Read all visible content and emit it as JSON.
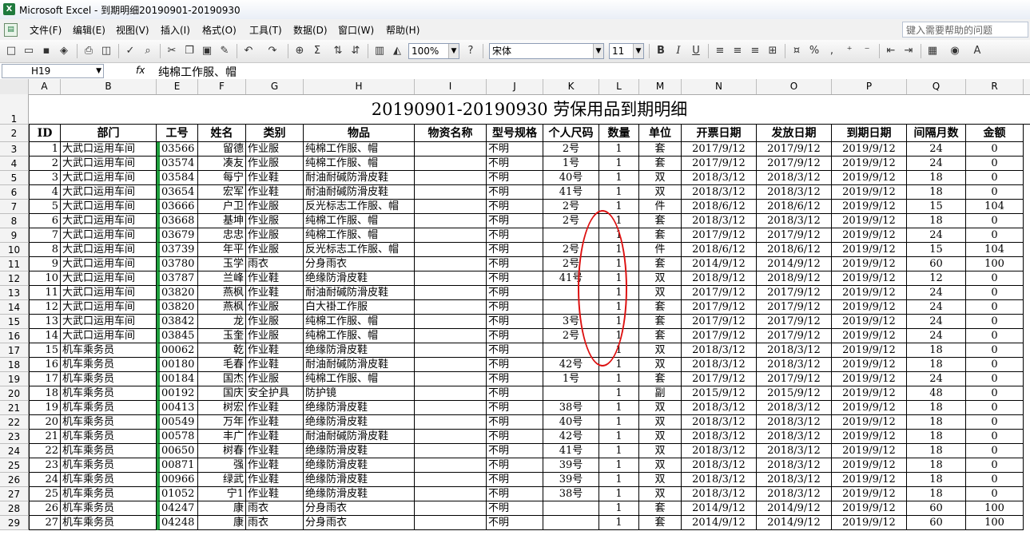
{
  "window": {
    "title": "Microsoft Excel - 到期明细20190901-20190930"
  },
  "menubar": {
    "items": [
      "文件(F)",
      "编辑(E)",
      "视图(V)",
      "插入(I)",
      "格式(O)",
      "工具(T)",
      "数据(D)",
      "窗口(W)",
      "帮助(H)"
    ],
    "help_placeholder": "键入需要帮助的问题"
  },
  "toolbar": {
    "zoom": "100%",
    "font_name": "宋体",
    "font_size": "11",
    "bold": "B",
    "italic": "I",
    "underline": "U",
    "sum": "Σ",
    "percent": "%",
    "comma": ","
  },
  "formula_bar": {
    "name_box": "H19",
    "fx": "fx",
    "content": "纯棉工作服、帽"
  },
  "columns": [
    "A",
    "B",
    "E",
    "F",
    "G",
    "H",
    "I",
    "J",
    "K",
    "L",
    "M",
    "N",
    "O",
    "P",
    "Q",
    "R"
  ],
  "row_numbers": [
    "1",
    "2",
    "3",
    "4",
    "5",
    "6",
    "7",
    "8",
    "9",
    "10",
    "11",
    "12",
    "13",
    "14",
    "15",
    "16",
    "17",
    "18",
    "19",
    "20",
    "21",
    "22",
    "23",
    "24",
    "25",
    "26",
    "27",
    "28",
    "29"
  ],
  "sheet": {
    "title": "20190901-20190930 劳保用品到期明细",
    "headers": [
      "ID",
      "部门",
      "工号",
      "姓名",
      "类别",
      "物品",
      "物资名称",
      "型号规格",
      "个人尺码",
      "数量",
      "单位",
      "开票日期",
      "发放日期",
      "到期日期",
      "间隔月数",
      "金额"
    ],
    "rows": [
      [
        "1",
        "大武口运用车间",
        "03566",
        "留德",
        "作业服",
        "纯棉工作服、帽",
        "",
        "不明",
        "2号",
        "1",
        "套",
        "2017/9/12",
        "2017/9/12",
        "2019/9/12",
        "24",
        "0"
      ],
      [
        "2",
        "大武口运用车间",
        "03574",
        "凑友",
        "作业服",
        "纯棉工作服、帽",
        "",
        "不明",
        "1号",
        "1",
        "套",
        "2017/9/12",
        "2017/9/12",
        "2019/9/12",
        "24",
        "0"
      ],
      [
        "3",
        "大武口运用车间",
        "03584",
        "每宁",
        "作业鞋",
        "耐油耐碱防滑皮鞋",
        "",
        "不明",
        "40号",
        "1",
        "双",
        "2018/3/12",
        "2018/3/12",
        "2019/9/12",
        "18",
        "0"
      ],
      [
        "4",
        "大武口运用车间",
        "03654",
        "宏军",
        "作业鞋",
        "耐油耐碱防滑皮鞋",
        "",
        "不明",
        "41号",
        "1",
        "双",
        "2018/3/12",
        "2018/3/12",
        "2019/9/12",
        "18",
        "0"
      ],
      [
        "5",
        "大武口运用车间",
        "03666",
        "户卫",
        "作业服",
        "反光标志工作服、帽",
        "",
        "不明",
        "2号",
        "1",
        "件",
        "2018/6/12",
        "2018/6/12",
        "2019/9/12",
        "15",
        "104"
      ],
      [
        "6",
        "大武口运用车间",
        "03668",
        "基坤",
        "作业服",
        "纯棉工作服、帽",
        "",
        "不明",
        "2号",
        "1",
        "套",
        "2018/3/12",
        "2018/3/12",
        "2019/9/12",
        "18",
        "0"
      ],
      [
        "7",
        "大武口运用车间",
        "03679",
        "忠忠",
        "作业服",
        "纯棉工作服、帽",
        "",
        "不明",
        "",
        "1",
        "套",
        "2017/9/12",
        "2017/9/12",
        "2019/9/12",
        "24",
        "0"
      ],
      [
        "8",
        "大武口运用车间",
        "03739",
        "年平",
        "作业服",
        "反光标志工作服、帽",
        "",
        "不明",
        "2号",
        "1",
        "件",
        "2018/6/12",
        "2018/6/12",
        "2019/9/12",
        "15",
        "104"
      ],
      [
        "9",
        "大武口运用车间",
        "03780",
        "玉学",
        "雨衣",
        "分身雨衣",
        "",
        "不明",
        "2号",
        "1",
        "套",
        "2014/9/12",
        "2014/9/12",
        "2019/9/12",
        "60",
        "100"
      ],
      [
        "10",
        "大武口运用车间",
        "03787",
        "兰峰",
        "作业鞋",
        "绝缘防滑皮鞋",
        "",
        "不明",
        "41号",
        "1",
        "双",
        "2018/9/12",
        "2018/9/12",
        "2019/9/12",
        "12",
        "0"
      ],
      [
        "11",
        "大武口运用车间",
        "03820",
        "燕枫",
        "作业鞋",
        "耐油耐碱防滑皮鞋",
        "",
        "不明",
        "",
        "1",
        "双",
        "2017/9/12",
        "2017/9/12",
        "2019/9/12",
        "24",
        "0"
      ],
      [
        "12",
        "大武口运用车间",
        "03820",
        "燕枫",
        "作业服",
        "白大褂工作服",
        "",
        "不明",
        "",
        "1",
        "套",
        "2017/9/12",
        "2017/9/12",
        "2019/9/12",
        "24",
        "0"
      ],
      [
        "13",
        "大武口运用车间",
        "03842",
        "龙",
        "作业服",
        "纯棉工作服、帽",
        "",
        "不明",
        "3号",
        "1",
        "套",
        "2017/9/12",
        "2017/9/12",
        "2019/9/12",
        "24",
        "0"
      ],
      [
        "14",
        "大武口运用车间",
        "03845",
        "玉奎",
        "作业服",
        "纯棉工作服、帽",
        "",
        "不明",
        "2号",
        "1",
        "套",
        "2017/9/12",
        "2017/9/12",
        "2019/9/12",
        "24",
        "0"
      ],
      [
        "15",
        "机车乘务员",
        "00062",
        "乾",
        "作业鞋",
        "绝缘防滑皮鞋",
        "",
        "不明",
        "",
        "1",
        "双",
        "2018/3/12",
        "2018/3/12",
        "2019/9/12",
        "18",
        "0"
      ],
      [
        "16",
        "机车乘务员",
        "00180",
        "毛春",
        "作业鞋",
        "耐油耐碱防滑皮鞋",
        "",
        "不明",
        "42号",
        "1",
        "双",
        "2018/3/12",
        "2018/3/12",
        "2019/9/12",
        "18",
        "0"
      ],
      [
        "17",
        "机车乘务员",
        "00184",
        "国杰",
        "作业服",
        "纯棉工作服、帽",
        "",
        "不明",
        "1号",
        "1",
        "套",
        "2017/9/12",
        "2017/9/12",
        "2019/9/12",
        "24",
        "0"
      ],
      [
        "18",
        "机车乘务员",
        "00192",
        "国庆",
        "安全护具",
        "防护镜",
        "",
        "不明",
        "",
        "1",
        "副",
        "2015/9/12",
        "2015/9/12",
        "2019/9/12",
        "48",
        "0"
      ],
      [
        "19",
        "机车乘务员",
        "00413",
        "树宏",
        "作业鞋",
        "绝缘防滑皮鞋",
        "",
        "不明",
        "38号",
        "1",
        "双",
        "2018/3/12",
        "2018/3/12",
        "2019/9/12",
        "18",
        "0"
      ],
      [
        "20",
        "机车乘务员",
        "00549",
        "万年",
        "作业鞋",
        "绝缘防滑皮鞋",
        "",
        "不明",
        "40号",
        "1",
        "双",
        "2018/3/12",
        "2018/3/12",
        "2019/9/12",
        "18",
        "0"
      ],
      [
        "21",
        "机车乘务员",
        "00578",
        "丰广",
        "作业鞋",
        "耐油耐碱防滑皮鞋",
        "",
        "不明",
        "42号",
        "1",
        "双",
        "2018/3/12",
        "2018/3/12",
        "2019/9/12",
        "18",
        "0"
      ],
      [
        "22",
        "机车乘务员",
        "00650",
        "树春",
        "作业鞋",
        "绝缘防滑皮鞋",
        "",
        "不明",
        "41号",
        "1",
        "双",
        "2018/3/12",
        "2018/3/12",
        "2019/9/12",
        "18",
        "0"
      ],
      [
        "23",
        "机车乘务员",
        "00871",
        "强",
        "作业鞋",
        "绝缘防滑皮鞋",
        "",
        "不明",
        "39号",
        "1",
        "双",
        "2018/3/12",
        "2018/3/12",
        "2019/9/12",
        "18",
        "0"
      ],
      [
        "24",
        "机车乘务员",
        "00966",
        "绿武",
        "作业鞋",
        "绝缘防滑皮鞋",
        "",
        "不明",
        "39号",
        "1",
        "双",
        "2018/3/12",
        "2018/3/12",
        "2019/9/12",
        "18",
        "0"
      ],
      [
        "25",
        "机车乘务员",
        "01052",
        "宁1",
        "作业鞋",
        "绝缘防滑皮鞋",
        "",
        "不明",
        "38号",
        "1",
        "双",
        "2018/3/12",
        "2018/3/12",
        "2019/9/12",
        "18",
        "0"
      ],
      [
        "26",
        "机车乘务员",
        "04247",
        "康",
        "雨衣",
        "分身雨衣",
        "",
        "不明",
        "",
        "1",
        "套",
        "2014/9/12",
        "2014/9/12",
        "2019/9/12",
        "60",
        "100"
      ],
      [
        "27",
        "机车乘务员",
        "04248",
        "康",
        "雨衣",
        "分身雨衣",
        "",
        "不明",
        "",
        "1",
        "套",
        "2014/9/12",
        "2014/9/12",
        "2019/9/12",
        "60",
        "100"
      ]
    ]
  }
}
